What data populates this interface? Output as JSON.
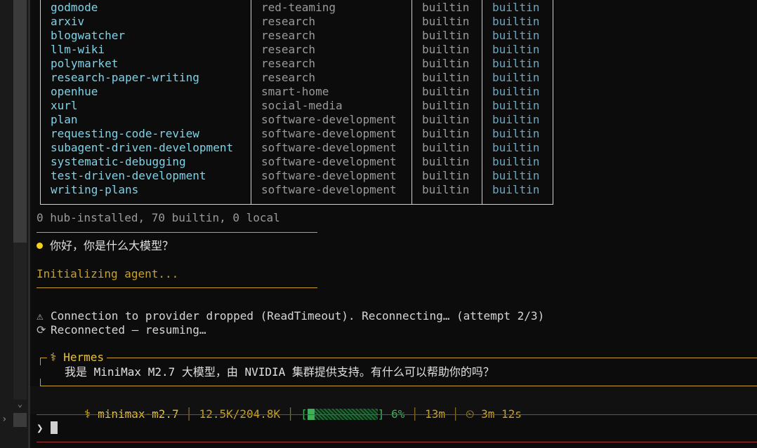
{
  "skills_table": {
    "rows": [
      {
        "name": "godmode",
        "category": "red-teaming",
        "source": "builtin",
        "trust": "builtin"
      },
      {
        "name": "arxiv",
        "category": "research",
        "source": "builtin",
        "trust": "builtin"
      },
      {
        "name": "blogwatcher",
        "category": "research",
        "source": "builtin",
        "trust": "builtin"
      },
      {
        "name": "llm-wiki",
        "category": "research",
        "source": "builtin",
        "trust": "builtin"
      },
      {
        "name": "polymarket",
        "category": "research",
        "source": "builtin",
        "trust": "builtin"
      },
      {
        "name": "research-paper-writing",
        "category": "research",
        "source": "builtin",
        "trust": "builtin"
      },
      {
        "name": "openhue",
        "category": "smart-home",
        "source": "builtin",
        "trust": "builtin"
      },
      {
        "name": "xurl",
        "category": "social-media",
        "source": "builtin",
        "trust": "builtin"
      },
      {
        "name": "plan",
        "category": "software-development",
        "source": "builtin",
        "trust": "builtin"
      },
      {
        "name": "requesting-code-review",
        "category": "software-development",
        "source": "builtin",
        "trust": "builtin"
      },
      {
        "name": "subagent-driven-development",
        "category": "software-development",
        "source": "builtin",
        "trust": "builtin"
      },
      {
        "name": "systematic-debugging",
        "category": "software-development",
        "source": "builtin",
        "trust": "builtin"
      },
      {
        "name": "test-driven-development",
        "category": "software-development",
        "source": "builtin",
        "trust": "builtin"
      },
      {
        "name": "writing-plans",
        "category": "software-development",
        "source": "builtin",
        "trust": "builtin"
      }
    ]
  },
  "summary": "0 hub-installed, 70 builtin, 0 local",
  "user_message": "你好，你是什么大模型？",
  "initializing": "Initializing agent...",
  "connection_warning": "Connection to provider dropped (ReadTimeout). Reconnecting… (attempt 2/3)",
  "reconnected": "Reconnected — resuming…",
  "icons": {
    "warning": "warning-icon",
    "reconnect": "reconnect-icon",
    "hermes": "caduceus-icon",
    "timer": "timer-icon",
    "prompt": "prompt-chevron-icon"
  },
  "hermes": {
    "title": "⚕ Hermes",
    "reply": "我是 MiniMax M2.7 大模型，由 NVIDIA 集群提供支持。有什么可以帮助你的吗？"
  },
  "status": {
    "model": "⚕ minimax-m2.7",
    "tokens": "12.5K/204.8K",
    "context_percent": "6%",
    "context_fraction": 0.06,
    "elapsed": "13m",
    "timer": "3m 12s"
  },
  "prompt": {
    "symbol": "❯"
  },
  "colors": {
    "accent_gold": "#c9a227",
    "name_cyan": "#7dd3e8",
    "progress_green": "#3fae5a",
    "divider_red": "#a23a3a"
  }
}
